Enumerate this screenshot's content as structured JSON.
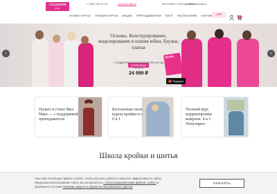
{
  "header": {
    "logo_main": "Академия",
    "logo_sub": "моды",
    "phone": "+7 (863) 303-61-04",
    "callback": "Заказать звонок",
    "hours": "Мы онлайн с 09:00 до 18:00",
    "email": "info@akademiya.ru",
    "nav": [
      "Очные курсы",
      "Онлайн-курсы",
      "Акции",
      "Преподаватели",
      "Блог",
      "Расписание",
      "Контакты"
    ],
    "promo_badge": "-20%",
    "cart_count": "0"
  },
  "hero": {
    "title": "Основы. Конструирование, моделирование и пошив юбки, блузки, платья",
    "offer": "ОТКРЫЕНИ",
    "offer_sub": "С ПОДДЕРЖКОЙ ПРЕПОДАВАТЕЛЯ НА ГОД",
    "old_price": "40 000 ₽",
    "price": "24 999 ₽",
    "magazine": "burda",
    "gift": "Подарок"
  },
  "cards": [
    {
      "text": "Пальто в стиле Max Mara — с поддержкой преподавателя"
    },
    {
      "text": "Бесплатные онлайн-курсы кройки и шитья 6 в 1"
    },
    {
      "text": "Полный курс корректировки выкроек: 4 в 1 Популярно"
    }
  ],
  "section_title": "Школа кройки и шитья",
  "cookie": {
    "line1": "Наш сайт использует файлы cookies, чтобы улучшить работу и повысить эффективность сайта.",
    "line2a": "Продолжая использование сайта, вы соглашаетесь ",
    "line2_link": "с использованием нами файлов cookies",
    "line2b": " и",
    "line3a": "принимаете условия ",
    "line3_link": "политики защиты и обработки персональных данных",
    "button": "ПРИНЯТЬ"
  },
  "colors": {
    "brand": "#e0318b",
    "hero_bg": "#ece6e4"
  }
}
